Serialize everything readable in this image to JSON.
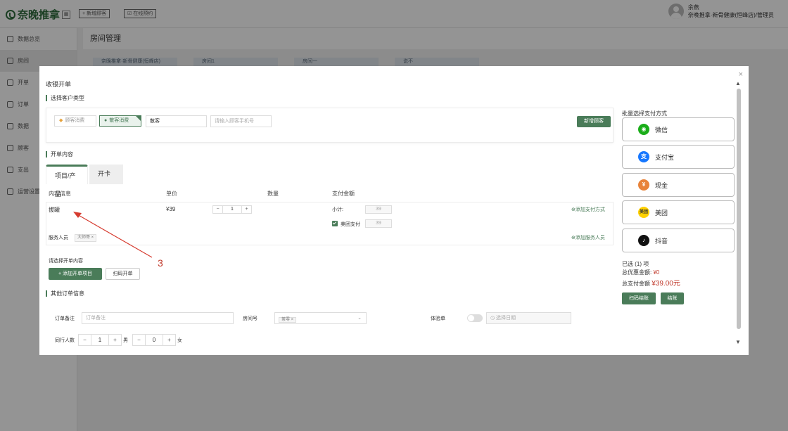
{
  "topbar": {
    "brand": "奈晚推拿",
    "new_customer": "新增顾客",
    "online_booking": "在线预约",
    "user_name": "余燕",
    "user_role": "奈晚推拿·新骨健康(恒峰店)/管理员"
  },
  "sidebar": {
    "items": [
      {
        "label": "数据总览"
      },
      {
        "label": "房间"
      },
      {
        "label": "开单"
      },
      {
        "label": "订单"
      },
      {
        "label": "数据"
      },
      {
        "label": "顾客"
      },
      {
        "label": "支出"
      },
      {
        "label": "运营设置"
      }
    ]
  },
  "main": {
    "title": "房间管理",
    "room_cards": [
      "奈晚推拿·新骨健康(恒峰店)",
      "房间1",
      "房间一",
      "说不"
    ]
  },
  "modal": {
    "title": "收银开单",
    "close": "×",
    "sec_customer": "选择客户类型",
    "member_btn": "顾客消费",
    "walkin_btn": "散客消费",
    "customer_name": "散客",
    "phone_placeholder": "请输入顾客手机号",
    "new_customer_btn": "新增顾客",
    "sec_order": "开单内容",
    "tab_items": "项目/产品",
    "tab_card": "开卡",
    "col_content": "内容信息",
    "col_price": "单价",
    "col_qty": "数量",
    "col_amount": "支付金额",
    "item_name": "拔罐",
    "item_price": "¥39",
    "item_qty": "1",
    "step_minus": "−",
    "step_plus": "+",
    "subtotal_label": "小计:",
    "subtotal_value": "39",
    "meituan_label": "美团支付",
    "meituan_value": "39",
    "add_pay_method": "⊕添加支付方式",
    "staff_label": "服务人员",
    "staff_tag": "大师哥 ×",
    "add_staff": "⊕添加服务人员",
    "annotation": "3",
    "select_content": "请选择开单内容",
    "add_item_btn": "+ 添加开单项目",
    "scan_btn": "扫码开单",
    "sec_other": "其他订单信息",
    "remark_label": "订单备注",
    "remark_placeholder": "订单备注",
    "room_label": "房间号",
    "room_tag": "茶零 ×",
    "trial_label": "体验单",
    "date_placeholder": "◷ 选择日期",
    "companions_label": "同行人数",
    "male_count": "1",
    "male_label": "男",
    "female_count": "0",
    "female_label": "女"
  },
  "payment": {
    "title": "批量选择支付方式",
    "methods": [
      {
        "label": "微信",
        "icon": "wechat-icon",
        "color": "#1aad19"
      },
      {
        "label": "支付宝",
        "icon": "alipay-icon",
        "color": "#1677ff"
      },
      {
        "label": "现金",
        "icon": "cash-icon",
        "color": "#e8833a"
      },
      {
        "label": "美团",
        "icon": "meituan-icon",
        "color": "#ffd100"
      },
      {
        "label": "抖音",
        "icon": "douyin-icon",
        "color": "#111111"
      }
    ],
    "selected": "已选 (1) 项",
    "discount_label": "总优惠金额:",
    "discount_value": "¥0",
    "total_label": "总支付金额",
    "total_value": "¥39.00元",
    "scan_checkout": "扫码结账",
    "checkout": "结账"
  }
}
